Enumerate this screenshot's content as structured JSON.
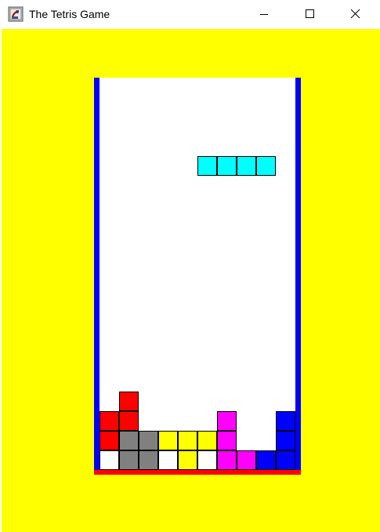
{
  "window": {
    "title": "The Tetris Game",
    "icon": "java-app-icon",
    "controls": [
      "minimize-icon",
      "maximize-icon",
      "close-icon"
    ]
  },
  "colors": {
    "background": "#ffff00",
    "well": "#ffffff",
    "walls": "#0000ff",
    "floor": "#ff0000",
    "cell_border": "#000000"
  },
  "board": {
    "columns": 10,
    "falling_piece": {
      "type": "I",
      "color": "#00ffff",
      "cells": [
        [
          5,
          4
        ],
        [
          6,
          4
        ],
        [
          7,
          4
        ],
        [
          8,
          4
        ]
      ]
    },
    "settled_cells": [
      {
        "col": 1,
        "row": 16,
        "color": "#ff0000"
      },
      {
        "col": 0,
        "row": 17,
        "color": "#ff0000"
      },
      {
        "col": 1,
        "row": 17,
        "color": "#ff0000"
      },
      {
        "col": 6,
        "row": 17,
        "color": "#ff00ff"
      },
      {
        "col": 9,
        "row": 17,
        "color": "#0000ff"
      },
      {
        "col": 0,
        "row": 18,
        "color": "#ff0000"
      },
      {
        "col": 1,
        "row": 18,
        "color": "#808080"
      },
      {
        "col": 2,
        "row": 18,
        "color": "#808080"
      },
      {
        "col": 3,
        "row": 18,
        "color": "#ffff00"
      },
      {
        "col": 4,
        "row": 18,
        "color": "#ffff00"
      },
      {
        "col": 5,
        "row": 18,
        "color": "#ffff00"
      },
      {
        "col": 6,
        "row": 18,
        "color": "#ff00ff"
      },
      {
        "col": 9,
        "row": 18,
        "color": "#0000ff"
      },
      {
        "col": 0,
        "row": 19,
        "color": "#ffffff"
      },
      {
        "col": 1,
        "row": 19,
        "color": "#808080"
      },
      {
        "col": 2,
        "row": 19,
        "color": "#808080"
      },
      {
        "col": 3,
        "row": 19,
        "color": "#ffffff"
      },
      {
        "col": 4,
        "row": 19,
        "color": "#ffff00"
      },
      {
        "col": 5,
        "row": 19,
        "color": "#ffffff"
      },
      {
        "col": 6,
        "row": 19,
        "color": "#ff00ff"
      },
      {
        "col": 7,
        "row": 19,
        "color": "#ff00ff"
      },
      {
        "col": 8,
        "row": 19,
        "color": "#0000ff"
      },
      {
        "col": 9,
        "row": 19,
        "color": "#0000ff"
      }
    ]
  }
}
